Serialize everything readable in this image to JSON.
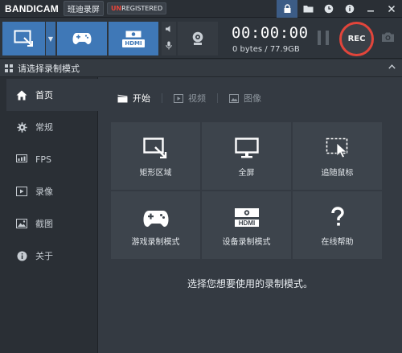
{
  "titlebar": {
    "logo": "BANDICAM",
    "brand_cn": "班迪录屏",
    "unregistered_prefix": "UN",
    "unregistered_rest": "REGISTERED",
    "icons": [
      "lock-icon",
      "folder-icon",
      "clock-icon",
      "info-icon",
      "minimize-icon",
      "close-icon"
    ]
  },
  "toolbar": {
    "mode_buttons": [
      "rectangle-mode",
      "game-mode",
      "hdmi-mode"
    ],
    "hdmi_label": "HDMI",
    "timer": "00:00:00",
    "size": "0 bytes / 77.9GB",
    "rec_label": "REC"
  },
  "section": {
    "title": "请选择录制模式"
  },
  "sidebar": {
    "items": [
      {
        "label": "首页",
        "icon": "home-icon"
      },
      {
        "label": "常规",
        "icon": "gear-icon"
      },
      {
        "label": "FPS",
        "icon": "fps-icon"
      },
      {
        "label": "录像",
        "icon": "video-icon"
      },
      {
        "label": "截图",
        "icon": "image-icon"
      },
      {
        "label": "关于",
        "icon": "info-icon"
      }
    ]
  },
  "tabs": [
    {
      "label": "开始",
      "active": true
    },
    {
      "label": "视频",
      "active": false
    },
    {
      "label": "图像",
      "active": false
    }
  ],
  "tiles": [
    {
      "label": "矩形区域",
      "icon": "rectangle-area-icon"
    },
    {
      "label": "全屏",
      "icon": "monitor-icon"
    },
    {
      "label": "追随鼠标",
      "icon": "follow-mouse-icon"
    },
    {
      "label": "游戏录制模式",
      "icon": "gamepad-icon"
    },
    {
      "label": "设备录制模式",
      "icon": "hdmi-device-icon"
    },
    {
      "label": "在线帮助",
      "icon": "question-icon"
    }
  ],
  "hint": "选择您想要使用的录制模式。",
  "colors": {
    "accent": "#3f78b7",
    "rec_ring": "#e2453b",
    "background": "#2b3138",
    "panel": "#343a42"
  }
}
